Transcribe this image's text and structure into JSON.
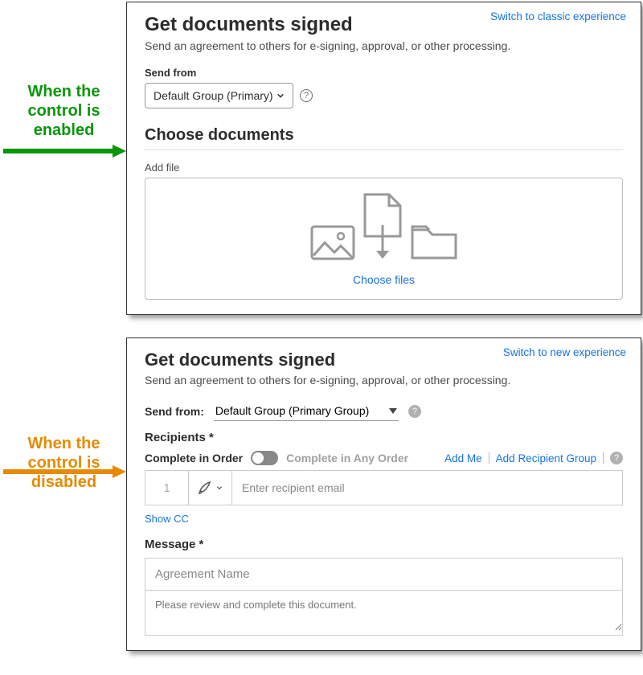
{
  "annotations": {
    "enabled": "When the control is enabled",
    "disabled": "When the control is disabled"
  },
  "panel1": {
    "switch_link": "Switch to classic experience",
    "title": "Get documents signed",
    "subtitle": "Send an agreement to others for e-signing, approval, or other processing.",
    "sendfrom_label": "Send from",
    "sendfrom_value": "Default Group (Primary)",
    "choose_docs": "Choose documents",
    "addfile_label": "Add file",
    "choose_files": "Choose files"
  },
  "panel2": {
    "switch_link": "Switch to new experience",
    "title": "Get documents signed",
    "subtitle": "Send an agreement to others for e-signing, approval, or other processing.",
    "sendfrom_label": "Send from:",
    "sendfrom_value": "Default Group (Primary Group)",
    "recipients_label": "Recipients *",
    "complete_in_order": "Complete in Order",
    "complete_any_order": "Complete in Any Order",
    "add_me": "Add Me",
    "add_group": "Add Recipient Group",
    "recipient_num": "1",
    "recipient_placeholder": "Enter recipient email",
    "show_cc": "Show CC",
    "message_label": "Message *",
    "agreement_name_placeholder": "Agreement Name",
    "message_body": "Please review and complete this document."
  }
}
